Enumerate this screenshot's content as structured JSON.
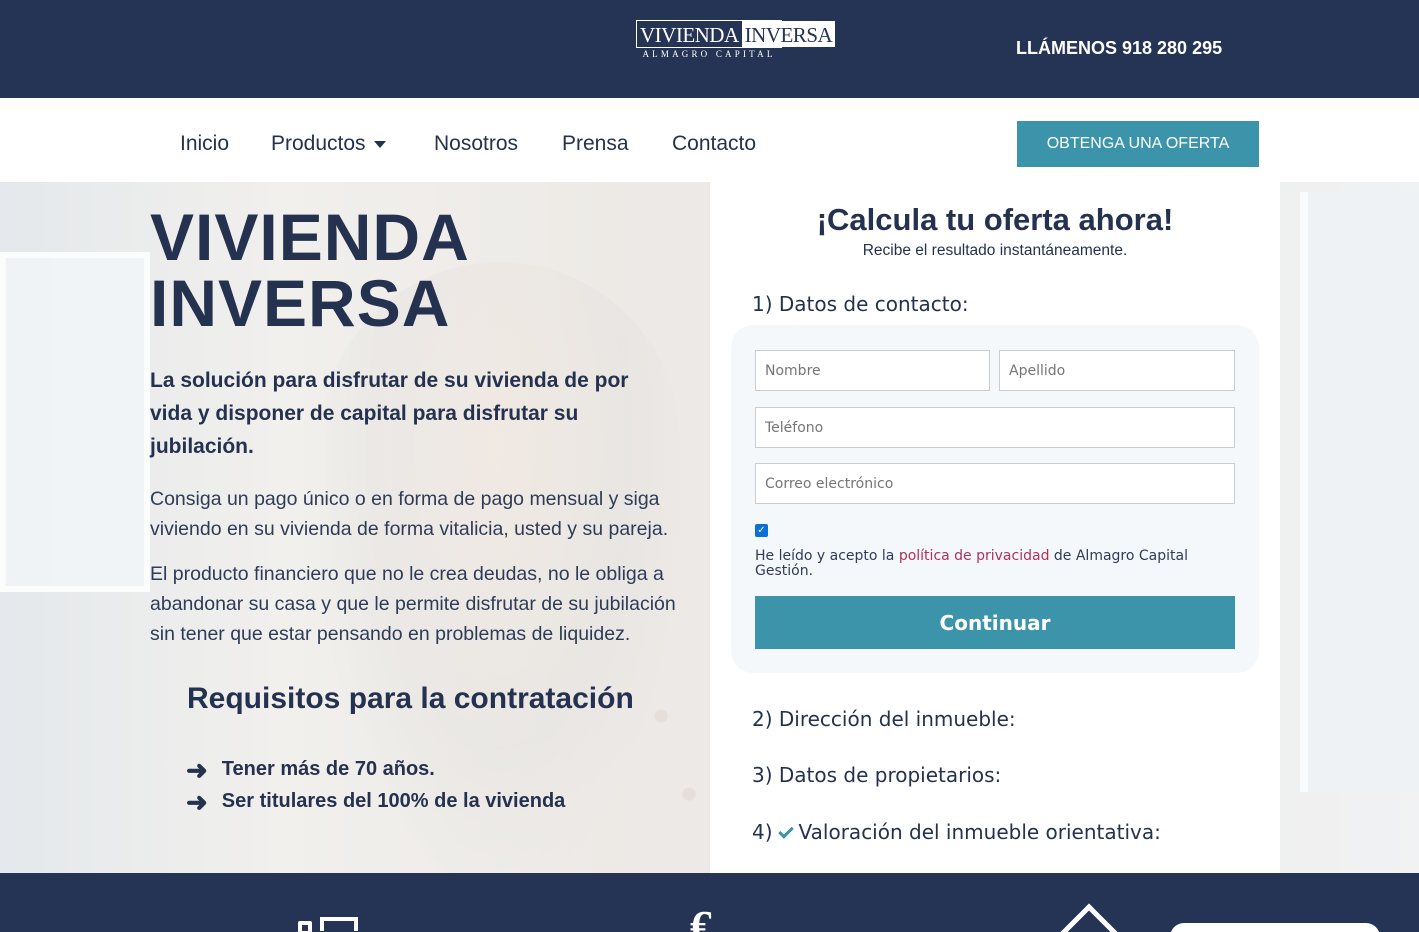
{
  "header": {
    "logo": {
      "left": "VIVIENDA",
      "right": "INVERSA",
      "sub": "ALMAGRO CAPITAL"
    },
    "phone": "LLÁMENOS 918 280 295"
  },
  "nav": {
    "items": [
      "Inicio",
      "Productos",
      "Nosotros",
      "Prensa",
      "Contacto"
    ],
    "cta": "OBTENGA UNA OFERTA"
  },
  "hero": {
    "title_line1": "VIVIENDA",
    "title_line2": "INVERSA",
    "lead": "La solución para disfrutar de su vivienda de por vida y disponer de capital para disfrutar su jubilación.",
    "p1": "Consiga un pago único o en forma de pago mensual y siga viviendo en su vivienda de forma vitalicia, usted y su pareja.",
    "p2": "El producto financiero que no le crea deudas, no le obliga a abandonar su casa y que le permite disfrutar de su jubilación sin tener que estar pensando en problemas de liquidez.",
    "requirements_title": "Requisitos para la contratación",
    "requirements": [
      "Tener más de 70 años.",
      "Ser titulares del 100% de la vivienda"
    ]
  },
  "form": {
    "title": "¡Calcula tu oferta ahora!",
    "subtitle": "Recibe el resultado instantáneamente.",
    "step1": "1) Datos de contacto:",
    "placeholders": {
      "first_name": "Nombre",
      "last_name": "Apellido",
      "phone": "Teléfono",
      "email": "Correo electrónico"
    },
    "consent_checked": true,
    "consent_prefix": "He leído y acepto la ",
    "consent_link": "política de privacidad",
    "consent_suffix": " de Almagro Capital Gestión.",
    "continue": "Continuar",
    "step2": "2) Dirección del inmueble:",
    "step3": "3) Datos de propietarios:",
    "step4_prefix": "4)",
    "step4_label": "Valoración del inmueble orientativa:"
  },
  "colors": {
    "navy": "#253455",
    "teal": "#3b94a9",
    "link": "#b0305a"
  }
}
